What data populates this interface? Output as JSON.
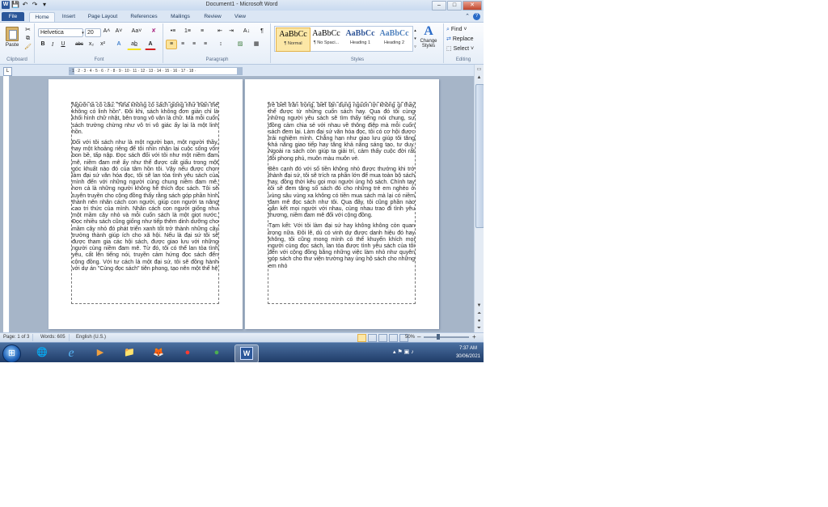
{
  "window": {
    "title": "Document1 - Microsoft Word",
    "minimize": "–",
    "maximize": "□",
    "close": "✕"
  },
  "qat": {
    "word": "W",
    "save": "💾",
    "undo": "↶",
    "redo": "↷",
    "customize": "▾"
  },
  "tabs": [
    "File",
    "Home",
    "Insert",
    "Page Layout",
    "References",
    "Mailings",
    "Review",
    "View"
  ],
  "ribbon": {
    "clipboard": {
      "paste": "Paste",
      "label": "Clipboard"
    },
    "font": {
      "name": "Helvetica",
      "size": "20",
      "grow": "A˄",
      "shrink": "A˅",
      "case": "Aa˅",
      "clear": "✘",
      "bold": "B",
      "italic": "I",
      "underline": "U",
      "strike": "abc",
      "sub": "x₂",
      "sup": "x²",
      "effects": "A",
      "highlight": "ab̲",
      "color": "A",
      "label": "Font"
    },
    "paragraph": {
      "bullets": "•≡",
      "numbering": "1≡",
      "multilevel": "≡",
      "decrease": "⇤",
      "increase": "⇥",
      "sort": "A↓",
      "pilcrow": "¶",
      "align_left": "≡",
      "center": "≡",
      "align_right": "≡",
      "justify": "≡",
      "spacing": "↕",
      "shading": "▨",
      "borders": "▦",
      "label": "Paragraph"
    },
    "styles": {
      "items": [
        {
          "sample": "AaBbCc",
          "name": "¶ Normal"
        },
        {
          "sample": "AaBbCc",
          "name": "¶ No Spaci..."
        },
        {
          "sample": "AaBbCc",
          "name": "Heading 1"
        },
        {
          "sample": "AaBbCc",
          "name": "Heading 2"
        }
      ],
      "change_styles": "Change Styles",
      "change_icon": "A",
      "label": "Styles"
    },
    "editing": {
      "find": "Find ˅",
      "replace": "Replace",
      "select": "Select ˅",
      "label": "Editing"
    }
  },
  "ruler": {
    "tab_selector": "L",
    "marks": "· 1 · 2 · 3 · 4 · 5 · 6 · 7 · 8 · 9 · 10 · 11 · 12 · 13 · 14 · 15 · 16 · 17 · 18 ·"
  },
  "page1": {
    "paragraphs": [
      "Người ta có câu: \"Nhà không có sách giống như thân thể không có linh hồn\". Đôi khi, sách không đơn giản chỉ là khối hình chữ nhật, bên trong vô văn là chữ. Mà mỗi cuốn sách trường chừng như vô tri vô giác ấy lại là một linh hồn.",
      "Đối với tôi sách như là một người bạn, một người thầy, hay một khoảng riêng để tôi nhìn nhận lại cuộc sống vốn bon bề, tấp nập. Đọc sách đối với tôi như một niềm đam mê, niềm đam mê ấy như thể được cất giấu trong một góc khuất nào đó của tâm hồn tôi. Vậy nếu được chọn làm đại sứ văn hóa đọc, tôi sẽ lan tỏa tình yêu sách của mình đến với những người cùng chung niềm đam mê, hơn cả là những người không hề thích đọc sách. Tôi sẽ tuyên truyền cho cộng đồng thấy rằng sách góp phần hình thành nên nhân cách con người, giúp con người ta nâng cao tri thức của mình. Nhân cách con người giống như một mầm cây nhỏ và mỗi cuốn sách là một giọt nước. Đọc nhiều sách cũng giống như tiếp thêm dinh dưỡng cho mầm cây nhỏ đó phát triển xanh tốt trở thành những cây trưởng thành giúp ích cho xã hội. Nếu là đại sứ tôi sẽ được tham gia các hội sách, được giao lưu với những người cùng niềm đam mê. Từ đó, tôi có thể lan tỏa tình yêu, cất lên tiếng nói, truyền cảm hứng đọc sách đến cộng đồng. Với tư cách là một đại sứ, tôi sẽ đồng hành với dự án \"Cùng đọc sách\" tiên phong, tạo nên một thế hệ"
    ]
  },
  "page2": {
    "paragraphs": [
      "trẻ biết trân trọng, biết tận dụng nguồn lợi không gì thay thế được từ những cuốn sách hay. Qua đó tôi cùng những người yêu sách sẽ tìm thấy tiếng nói chung, sự đồng cảm chia sẻ với nhau về thông điệp mà mỗi cuốn sách đem lại. Làm đại sứ văn hóa đọc, tôi có cơ hội được trải nghiệm mình. Chẳng hạn như giao lưu giúp tôi tăng khả năng giao tiếp hay tăng khả năng sáng tạo, tư duy. Ngoài ra sách còn giúp ta giải trí, cảm thấy cuộc đời rất đỗi phong phú, muôn màu muôn vẻ.",
      "Bên cạnh đó với số tiền không nhỏ được thưởng khi trở thành đại sứ, tôi sẽ trích ra phần lớn để mua toàn bộ sách hay, đồng thời kêu gọi mọi người ủng hộ sách. Chính tay tôi sẽ đem tặng số sách đó cho những trẻ em nghèo ở vùng sâu vùng xa không có tiền mua sách mà lại có niềm đam mê đọc sách như tôi. Qua đây, tôi cũng phần nào gắn kết mọi người với nhau, cùng nhau trao đi tình yêu thương, niềm đam mê đối với cộng đồng.",
      "Tạm kết: Với tôi làm đại sứ hay không không còn quan trọng nữa. Đôi lẽ, dù có vinh dự được danh hiệu đó hay không, tôi cũng mong mình có thể khuyến khích mọi người cùng đọc sách, lan tỏa được tình yêu sách của tôi đến với cộng đồng bằng những việc làm nhỏ như quyên góp sách cho thư viện trường hay ủng hộ sách cho những em nhỏ"
    ]
  },
  "status": {
    "page": "Page: 1 of 3",
    "words": "Words: 605",
    "language": "English (U.S.)",
    "zoom": "50%",
    "zoom_out": "–",
    "zoom_in": "+"
  },
  "taskbar": {
    "start": "⊞",
    "apps": [
      "🌐",
      "e",
      "▶",
      "📁",
      "🦊",
      "●",
      "●",
      "W"
    ],
    "time": "7:37 AM",
    "date": "30/06/2021",
    "tray": "▴ ⚑ ▣ ♪"
  }
}
